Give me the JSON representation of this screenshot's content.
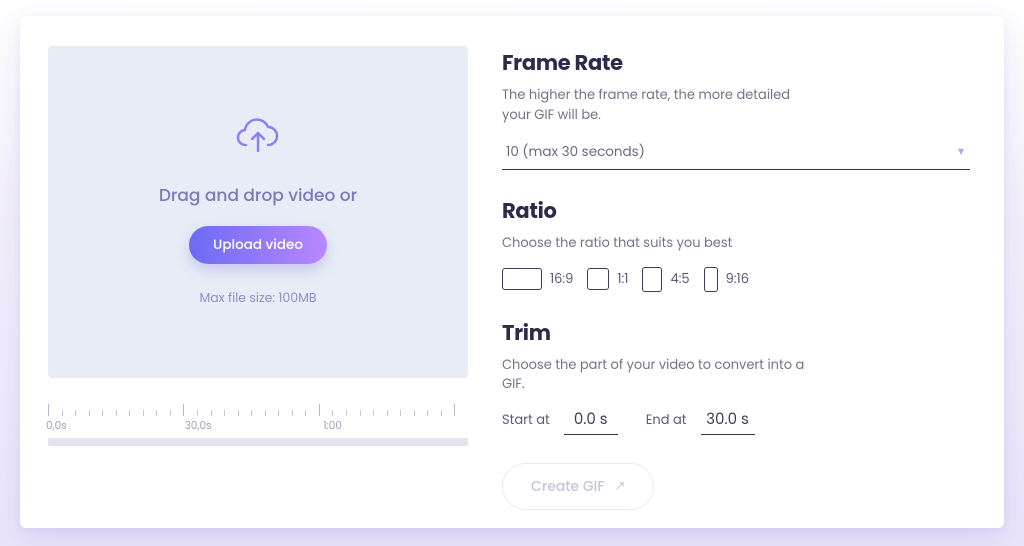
{
  "upload": {
    "drag_text": "Drag and drop video or",
    "button_label": "Upload video",
    "max_size_text": "Max file size: 100MB"
  },
  "timeline": {
    "labels": [
      "0,0s",
      "30,0s",
      "1:00"
    ]
  },
  "frame_rate": {
    "heading": "Frame Rate",
    "desc": "The higher the frame rate, the more detailed your GIF will be.",
    "selected": "10 (max 30 seconds)"
  },
  "ratio": {
    "heading": "Ratio",
    "desc": "Choose the ratio that suits you best",
    "options": [
      "16:9",
      "1:1",
      "4:5",
      "9:16"
    ]
  },
  "trim": {
    "heading": "Trim",
    "desc": "Choose the part of your video to convert into a GIF.",
    "start_label": "Start at",
    "start_value": "0.0 s",
    "end_label": "End at",
    "end_value": "30.0 s"
  },
  "create": {
    "label": "Create GIF"
  }
}
